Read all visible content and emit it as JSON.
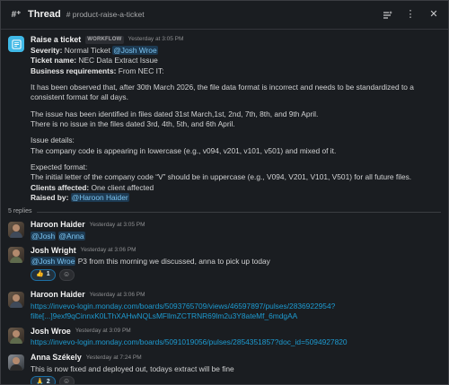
{
  "header": {
    "title": "Thread",
    "channel": "# product-raise-a-ticket",
    "icons": [
      "thread-icon",
      "sparkle-sort-icon",
      "more-icon",
      "close-icon"
    ]
  },
  "parent": {
    "author": "Raise a ticket",
    "tag": "WORKFLOW",
    "time": "Yesterday at 3:05 PM",
    "severity_label": "Severity:",
    "severity_value": "Normal Ticket",
    "severity_mention": "@Josh Wroe",
    "ticket_label": "Ticket name:",
    "ticket_value": "NEC Data Extract Issue",
    "biz_label": "Business requirements:",
    "biz_value": "From NEC IT:",
    "p1": "It has been observed that, after 30th March 2026, the file data format is incorrect and needs to be standardized to a consistent format for all days.",
    "p2a": "The issue has been identified in files dated 31st March,1st, 2nd, 7th, 8th, and 9th April.",
    "p2b": "There is no issue in the files dated 3rd, 4th, 5th, and 6th April.",
    "p3a": "Issue details:",
    "p3b": "The company code is appearing in lowercase (e.g., v094, v201, v101, v501) and mixed of it.",
    "p4a": "Expected format:",
    "p4b": "The initial letter of the company code “V” should be in uppercase (e.g., V094, V201, V101, V501) for all future files.",
    "clients_label": "Clients affected:",
    "clients_value": "One client affected",
    "raised_label": "Raised by:",
    "raised_mention": "@Haroon Haider"
  },
  "replies_label": "5 replies",
  "replies": [
    {
      "author": "Haroon Haider",
      "time": "Yesterday at 3:05 PM",
      "mention1": "@Josh",
      "mention2": "@Anna"
    },
    {
      "author": "Josh Wright",
      "time": "Yesterday at 3:06 PM",
      "mention": "@Josh Wroe",
      "text": "P3 from this morning we discussed, anna to pick up today",
      "reaction_emoji": "👍",
      "reaction_count": "1"
    },
    {
      "author": "Haroon Haider",
      "time": "Yesterday at 3:06 PM",
      "link1": "https://invevo-login.monday.com/boards/5093765709/views/46597897/pulses/2836922954?",
      "link2": "filte[...]9exf9qCinnxK0LThXAHwNQLsMFllmZCTRNR69lm2u3Y8ateMf_6mdgAA"
    },
    {
      "author": "Josh Wroe",
      "time": "Yesterday at 3:09 PM",
      "link1": "https://invevo-login.monday.com/boards/5091019056/pulses/2854351857?doc_id=5094927820"
    },
    {
      "author": "Anna Székely",
      "time": "Yesterday at 7:24 PM",
      "text": "This is now fixed and deployed out, todays extract will be fine",
      "reaction_emoji": "🙏",
      "reaction_count": "2"
    }
  ],
  "colors": {
    "background": "#1a1d21",
    "text": "#d1d2d3",
    "link": "#1d9bd1",
    "mention_bg": "#1d3a52",
    "mention_text": "#7cc5f2",
    "bot_avatar": "#3fb8e6"
  }
}
